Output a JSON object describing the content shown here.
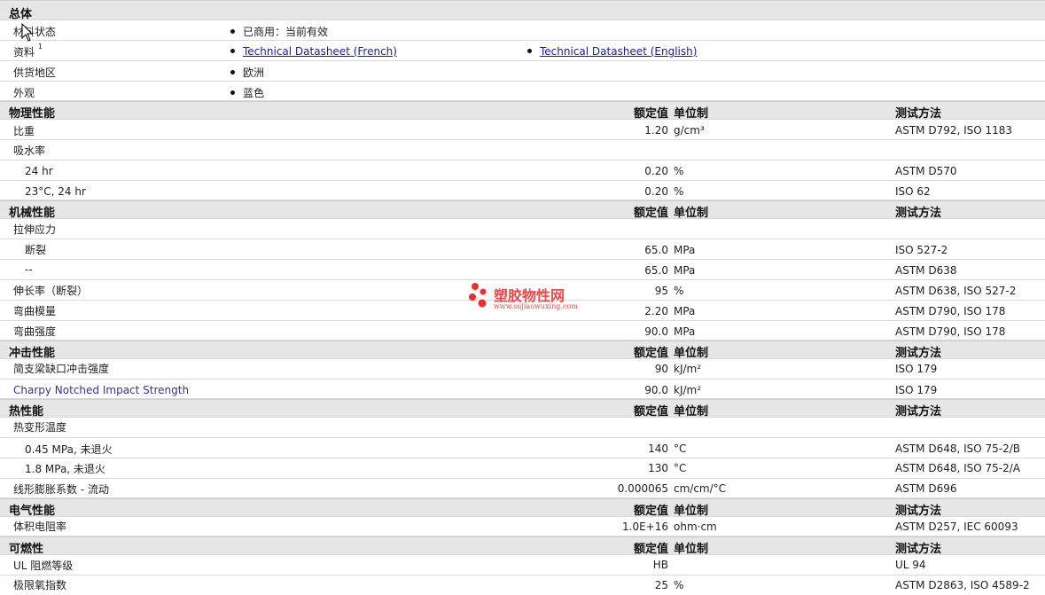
{
  "general": {
    "title": "总体",
    "rows": [
      {
        "label": "材料状态",
        "items": [
          "已商用：当前有效"
        ]
      },
      {
        "label": "资料",
        "sup": "1",
        "links": [
          "Technical Datasheet (French)",
          "Technical Datasheet (English)"
        ]
      },
      {
        "label": "供货地区",
        "items": [
          "欧洲"
        ]
      },
      {
        "label": "外观",
        "items": [
          "蓝色"
        ]
      }
    ]
  },
  "headers": {
    "value": "额定值",
    "unit": "单位制",
    "method": "测试方法"
  },
  "sections": [
    {
      "title": "物理性能",
      "rows": [
        {
          "label": "比重",
          "value": "1.20",
          "unit": "g/cm³",
          "method": "ASTM D792, ISO 1183"
        },
        {
          "label": "吸水率"
        },
        {
          "label": "24 hr",
          "value": "0.20",
          "unit": "%",
          "method": "ASTM D570"
        },
        {
          "label": "23°C, 24 hr",
          "value": "0.20",
          "unit": "%",
          "method": "ISO 62"
        }
      ]
    },
    {
      "title": "机械性能",
      "rows": [
        {
          "label": "拉伸应力"
        },
        {
          "label": "断裂",
          "value": "65.0",
          "unit": "MPa",
          "method": "ISO 527-2"
        },
        {
          "label": "--",
          "value": "65.0",
          "unit": "MPa",
          "method": "ASTM D638"
        },
        {
          "label": "伸长率（断裂）",
          "value": "95",
          "unit": "%",
          "method": "ASTM D638, ISO 527-2"
        },
        {
          "label": "弯曲模量",
          "value": "2.20",
          "unit": "MPa",
          "method": "ASTM D790, ISO 178"
        },
        {
          "label": "弯曲强度",
          "value": "90.0",
          "unit": "MPa",
          "method": "ASTM D790, ISO 178"
        }
      ]
    },
    {
      "title": "冲击性能",
      "rows": [
        {
          "label": "简支梁缺口冲击强度",
          "value": "90",
          "unit": "kJ/m²",
          "method": "ISO 179"
        },
        {
          "label": "Charpy Notched Impact Strength",
          "value": "90.0",
          "unit": "kJ/m²",
          "method": "ISO 179"
        }
      ]
    },
    {
      "title": "热性能",
      "rows": [
        {
          "label": "热变形温度"
        },
        {
          "label": "0.45 MPa, 未退火",
          "value": "140",
          "unit": "°C",
          "method": "ASTM D648, ISO 75-2/B"
        },
        {
          "label": "1.8 MPa, 未退火",
          "value": "130",
          "unit": "°C",
          "method": "ASTM D648, ISO 75-2/A"
        },
        {
          "label": "线形膨胀系数 - 流动",
          "value": "0.000065",
          "unit": "cm/cm/°C",
          "method": "ASTM D696"
        }
      ]
    },
    {
      "title": "电气性能",
      "rows": [
        {
          "label": "体积电阻率",
          "value": "1.0E+16",
          "unit": "ohm·cm",
          "method": "ASTM D257, IEC 60093"
        }
      ]
    },
    {
      "title": "可燃性",
      "rows": [
        {
          "label": "UL 阻燃等级",
          "value": "HB",
          "unit": "",
          "method": "UL 94"
        },
        {
          "label": "极限氧指数",
          "value": "25",
          "unit": "%",
          "method": "ASTM D2863, ISO 4589-2"
        }
      ]
    }
  ],
  "watermark": {
    "title": "塑胶物性网",
    "url": "www.sujiaowuxing.com"
  },
  "colors": {
    "section_bg": "#e6e6e6",
    "link": "#1a1aa6",
    "watermark": "#e84a4a"
  }
}
